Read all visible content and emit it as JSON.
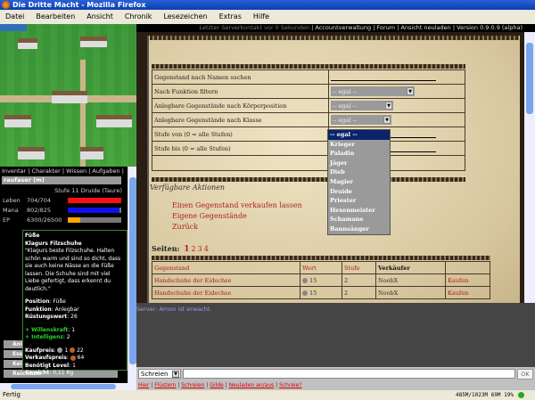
{
  "window": {
    "title": "Die Dritte Macht - Mozilla Firefox"
  },
  "menu": [
    "Datei",
    "Bearbeiten",
    "Ansicht",
    "Chronik",
    "Lesezeichen",
    "Extras",
    "Hilfe"
  ],
  "topbar": {
    "last_contact": "Letzter Serverkontakt vor 0 Sekunden",
    "links": [
      "Accountverwaltung",
      "Forum",
      "Ansicht neuladen"
    ],
    "version": "Version 0.9.0.9 (alpha)"
  },
  "left": {
    "tabs": "Inventar | Charakter | Wissen | Aufgaben | Log",
    "name": "raufaser (m)",
    "level": "Stufe 11 Druide (Taure)",
    "stats": [
      {
        "label": "Leben",
        "value": "704/704",
        "fill": 1.0,
        "color": "#ff1010"
      },
      {
        "label": "Mana",
        "value": "802/825",
        "fill": 0.97,
        "color": "#1010ee"
      },
      {
        "label": "EP",
        "value": "6300/26500",
        "fill": 0.24,
        "color": "#ffa500"
      }
    ],
    "buttons": [
      "Ani",
      "Ess",
      "Kei",
      "Reichtum"
    ],
    "tooltip": {
      "slot": "Füße",
      "name": "Klagurs Filzschuhe",
      "desc": "\"Klagurs beste Filzschuhe. Halten schön warm und sind so dicht, dass sie auch keine Nässe an die Füße lassen. Die Schuhe sind mit viel Liebe gefertigt, dass erkennt du deutlich.\"",
      "position_label": "Position",
      "position": "Füße",
      "function_label": "Funktion",
      "function": "Anlegbar",
      "armor_label": "Rüstungswert",
      "armor": "26",
      "bonus": [
        {
          "label": "+ Willenskraft",
          "value": "1"
        },
        {
          "label": "+ Intelligenz",
          "value": "2"
        }
      ],
      "buy_label": "Kaufpreis",
      "buy_silver": "1",
      "buy_copper": "22",
      "sell_label": "Verkaufspreis",
      "sell_copper": "64",
      "level_label": "Benötigt Level",
      "level": "1",
      "weight_label": "Gewicht",
      "weight": "0,11 Kg"
    }
  },
  "form": {
    "rows": [
      {
        "label": "Gegenstand nach Namen suchen",
        "value": ""
      },
      {
        "label": "Nach Funktion filtern",
        "value": "-- egal --"
      },
      {
        "label": "Anlegbare Gegenstände nach Körperposition",
        "value": "-- egal --"
      },
      {
        "label": "Anlegbare Gegenstände nach Klasse",
        "value": "-- egal --"
      },
      {
        "label": "Stufe von (0 = alle Stufen)",
        "value": ""
      },
      {
        "label": "Stufe bis (0 = alle Stufen)",
        "value": ""
      }
    ],
    "class_options": [
      "-- egal --",
      "Krieger",
      "Paladin",
      "Jäger",
      "Dieb",
      "Magier",
      "Druide",
      "Priester",
      "Hexenmeister",
      "Schamane",
      "Bannsänger"
    ]
  },
  "actions": {
    "title": "Verfügbare Aktionen",
    "links": [
      "Einen Gegenstand verkaufen lassen",
      "Eigene Gegenstände",
      "Zurück"
    ]
  },
  "pages": {
    "label": "Seiten:",
    "items": [
      "1",
      "2",
      "3",
      "4"
    ],
    "current": "1"
  },
  "items": {
    "headers": [
      "Gegenstand",
      "Wert",
      "Stufe",
      "Verkäufer",
      ""
    ],
    "rows": [
      {
        "name": "Handschuhe der Eidechse",
        "value": "15",
        "level": "2",
        "seller": "NoobX",
        "action": "Kaufen"
      },
      {
        "name": "Handschuhe der Eidechse",
        "value": "15",
        "level": "2",
        "seller": "NoobX",
        "action": "Kaufen"
      }
    ]
  },
  "chat": {
    "message": "Server: Amon ist erwacht.",
    "mode": "Schreien",
    "input": "",
    "ok": "OK",
    "links": [
      "Hier",
      "Flüstern",
      "Schreien",
      "Gilde",
      "Neuladen an/aus",
      "Schreie?"
    ]
  },
  "status": {
    "text": "Fertig",
    "memory": "485M/1023M  69M 19%"
  }
}
